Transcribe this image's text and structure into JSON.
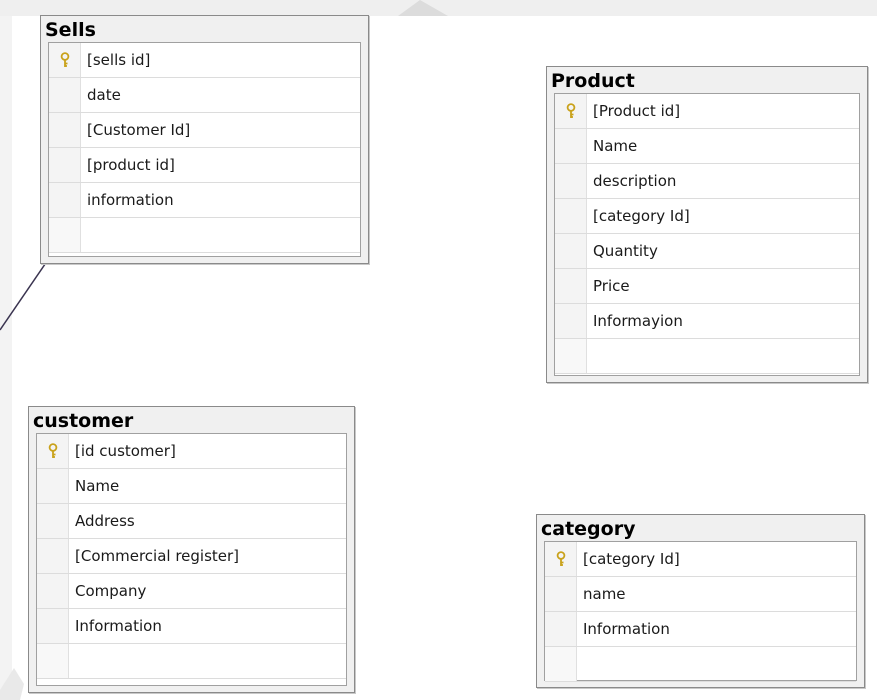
{
  "tables": [
    {
      "id": "sells",
      "title": "Sells",
      "columns": [
        {
          "label": "[sells id]",
          "primary_key": true
        },
        {
          "label": "date",
          "primary_key": false
        },
        {
          "label": "[Customer Id]",
          "primary_key": false
        },
        {
          "label": "[product id]",
          "primary_key": false
        },
        {
          "label": "information",
          "primary_key": false
        }
      ]
    },
    {
      "id": "product",
      "title": "Product",
      "columns": [
        {
          "label": "[Product id]",
          "primary_key": true
        },
        {
          "label": "Name",
          "primary_key": false
        },
        {
          "label": "description",
          "primary_key": false
        },
        {
          "label": "[category Id]",
          "primary_key": false
        },
        {
          "label": "Quantity",
          "primary_key": false
        },
        {
          "label": "Price",
          "primary_key": false
        },
        {
          "label": "Informayion",
          "primary_key": false
        }
      ]
    },
    {
      "id": "customer",
      "title": "customer",
      "columns": [
        {
          "label": "[id customer]",
          "primary_key": true
        },
        {
          "label": "Name",
          "primary_key": false
        },
        {
          "label": "Address",
          "primary_key": false
        },
        {
          "label": "[Commercial register]",
          "primary_key": false
        },
        {
          "label": "Company",
          "primary_key": false
        },
        {
          "label": "Information",
          "primary_key": false
        }
      ]
    },
    {
      "id": "category",
      "title": "category",
      "columns": [
        {
          "label": "[category Id]",
          "primary_key": true
        },
        {
          "label": "name",
          "primary_key": false
        },
        {
          "label": "Information",
          "primary_key": false
        }
      ]
    }
  ],
  "colors": {
    "background": "#ffffff",
    "table_frame": "#f0f0f0",
    "table_border": "#8a8a8a",
    "key_icon": "#c9a21b",
    "relationship_line": "#3a3450",
    "watermark_shape": "#e4e4e4"
  },
  "icons": {
    "primary_key": "key-icon"
  }
}
